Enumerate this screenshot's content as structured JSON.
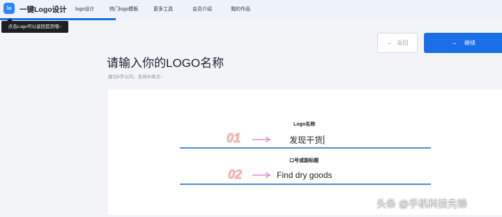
{
  "header": {
    "logo_mark_text": "lo",
    "brand": "一键Logo设计",
    "nav": {
      "logo_design": "logo设计",
      "hot_templates": "热门logo模板",
      "more_tools": "更多工具",
      "membership": "会员介绍",
      "my_works": "我的作品"
    },
    "tooltip": "点击Logo可以返回首页哦~"
  },
  "actions": {
    "back_label": "返回",
    "continue_label": "继续"
  },
  "page": {
    "title": "请输入你的LOGO名称",
    "subtitle": "建议6字以内，支持中英文~"
  },
  "form": {
    "name_label": "Logo名称",
    "name_value": "发现干货",
    "slogan_label": "口号或副标题",
    "slogan_value": "Find dry goods"
  },
  "annotations": {
    "step1": "01",
    "step2": "02"
  },
  "watermark": "头条 @手机科技先锋",
  "colors": {
    "primary": "#1a6fe8",
    "input_underline": "#4a8ed6",
    "step_number": "#f7c3c3",
    "step_arrow": "#e38fd8"
  }
}
